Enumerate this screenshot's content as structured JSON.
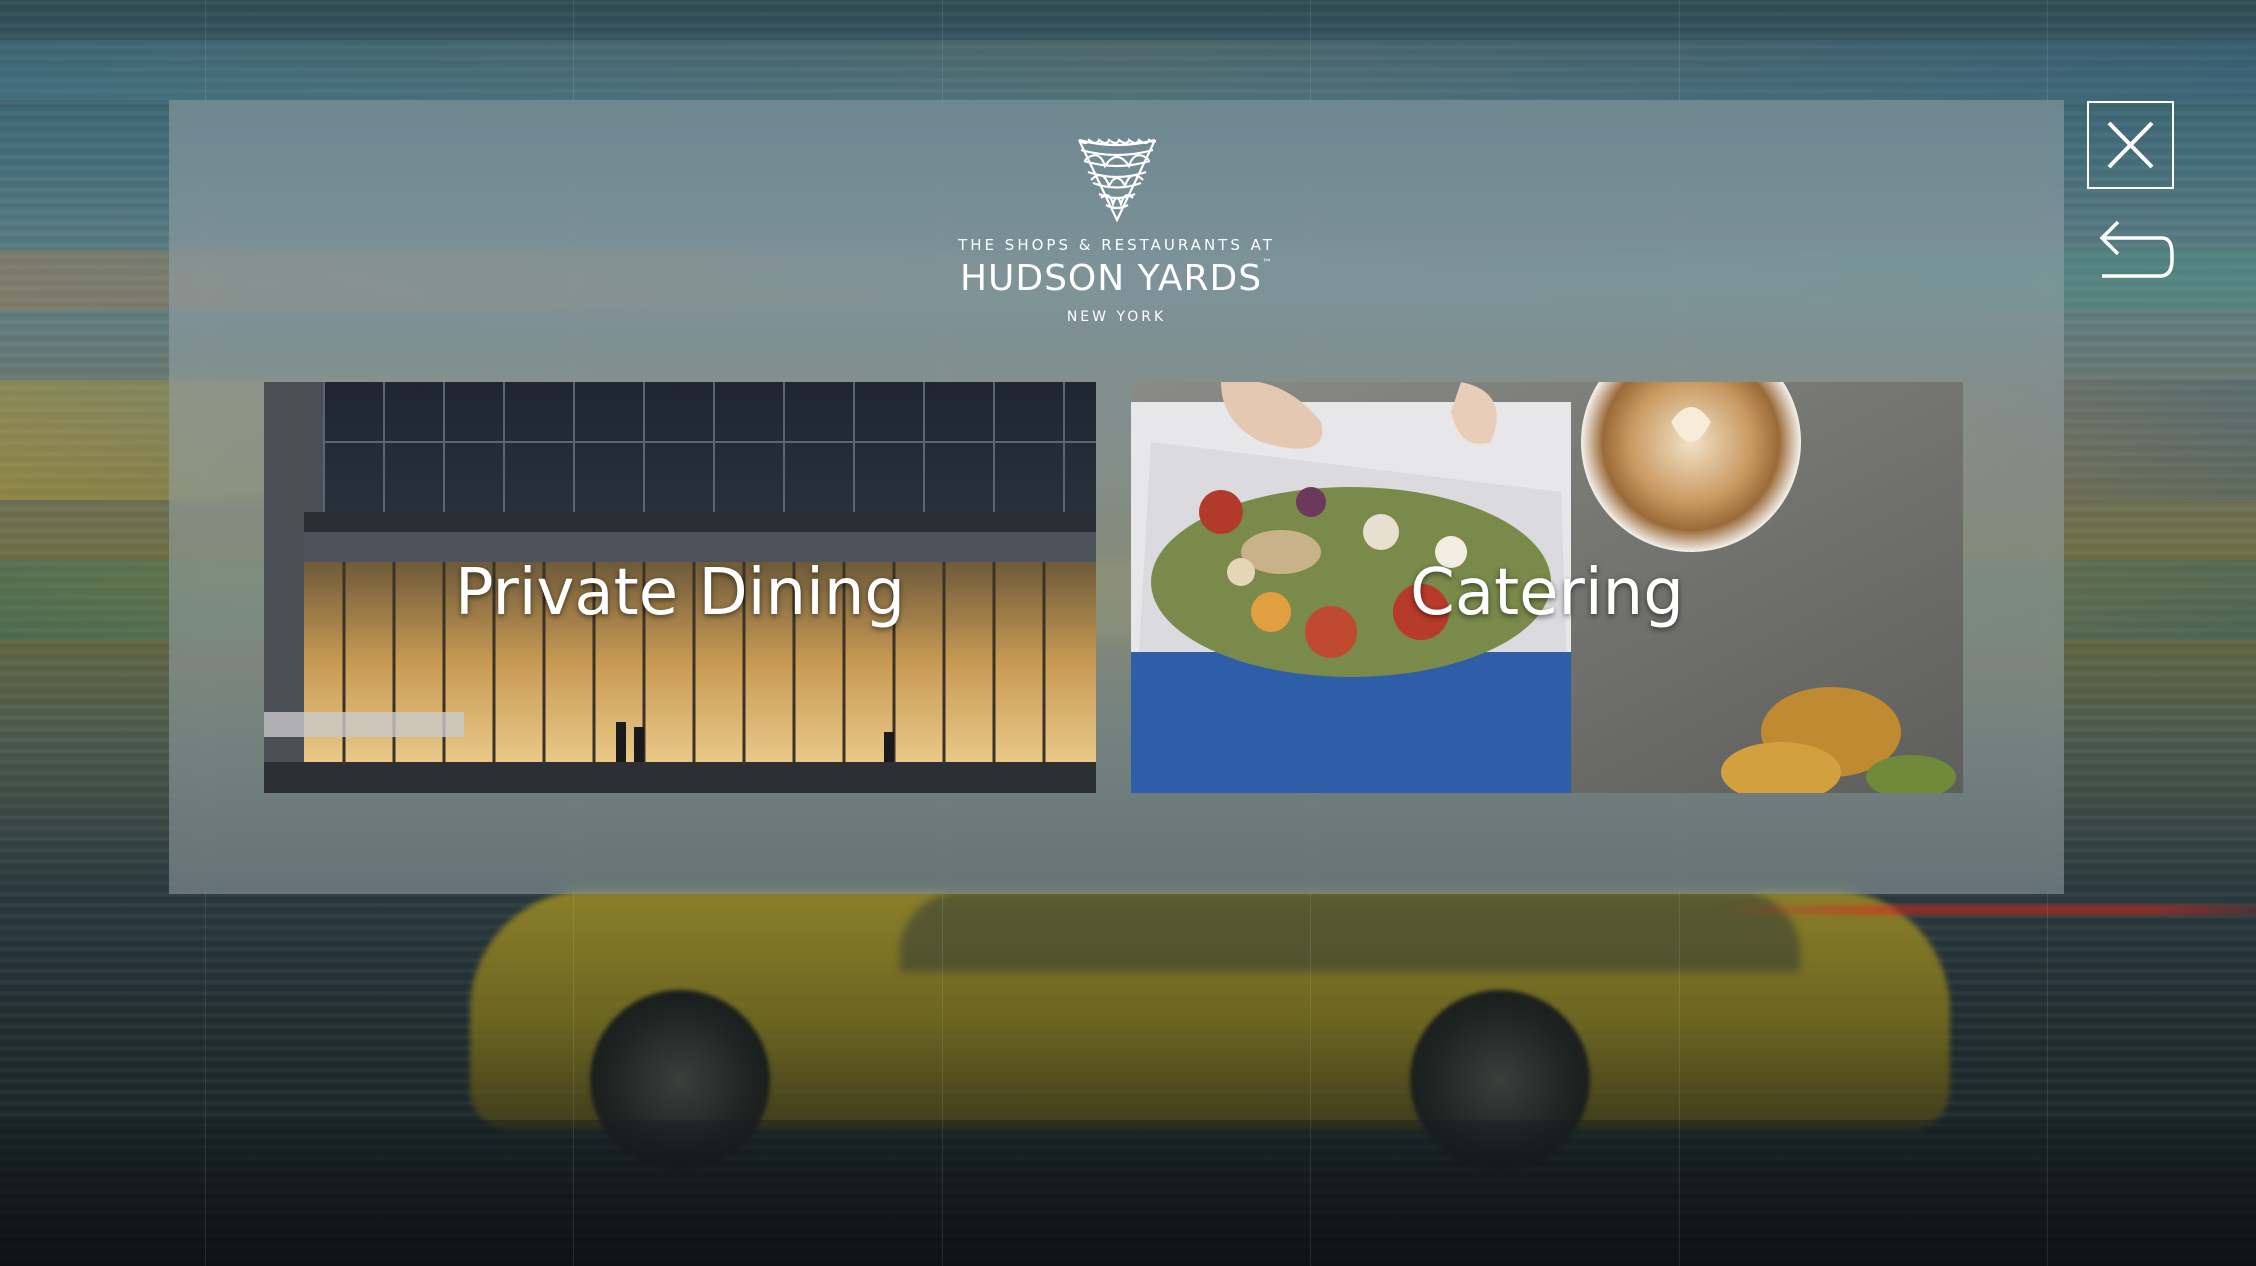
{
  "logo": {
    "line_top": "THE SHOPS & RESTAURANTS AT",
    "line_main": "HUDSON YARDS",
    "trademark": "™",
    "line_sub": "NEW YORK"
  },
  "tiles": [
    {
      "label": "Private Dining"
    },
    {
      "label": "Catering"
    }
  ],
  "controls": {
    "close_icon": "close-icon",
    "back_icon": "back-arrow-icon"
  },
  "colors": {
    "text": "#ffffff",
    "dialog_overlay": "#96a2a8"
  }
}
